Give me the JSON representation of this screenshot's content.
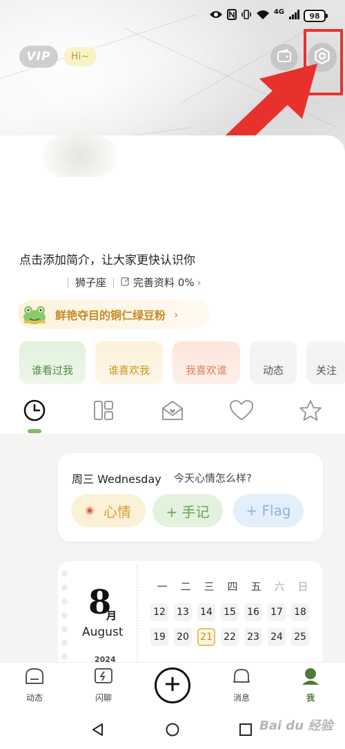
{
  "status_bar": {
    "icons": [
      "eye-icon",
      "nfc-icon",
      "vibrate-icon",
      "wifi-icon",
      "signal-icon"
    ],
    "network": "4G",
    "battery": "98"
  },
  "header": {
    "vip_label": "VIP",
    "greeting": "Hi~",
    "icons": [
      "wallet-icon",
      "settings-icon"
    ],
    "highlight_color": "#e8312d"
  },
  "profile": {
    "bio_prompt": "点击添加简介，让大家更快认识你",
    "zodiac": "狮子座",
    "complete_profile": "完善资料 0%",
    "music": "鲜艳夺目的铜仁绿豆粉"
  },
  "quick_actions": [
    "谁看过我",
    "谁喜欢我",
    "我喜欢谁",
    "动态",
    "关注"
  ],
  "content_tabs": {
    "icons": [
      "clock-icon",
      "layout-icon",
      "mail-icon",
      "heart-icon",
      "star-icon"
    ],
    "active_index": 0
  },
  "diary": {
    "day": "周三 Wednesday",
    "prompt": "今天心情怎么样?",
    "buttons": [
      "心情",
      "+ 手记",
      "+ Flag"
    ]
  },
  "calendar": {
    "month_number": "8",
    "month_suffix": "月",
    "month_name": "August",
    "year": "2024",
    "weekdays": [
      "一",
      "二",
      "三",
      "四",
      "五",
      "六",
      "日"
    ],
    "week1": [
      "12",
      "13",
      "14",
      "15",
      "16",
      "17",
      "18"
    ],
    "week2": [
      "19",
      "20",
      "21",
      "22",
      "23",
      "24",
      "25"
    ],
    "today": "21"
  },
  "bottom_nav": {
    "items": [
      "动态",
      "闪聊",
      "消息",
      "我"
    ],
    "active": "我",
    "accent_color": "#4d7a3b"
  },
  "watermark": "Bai du 经验"
}
